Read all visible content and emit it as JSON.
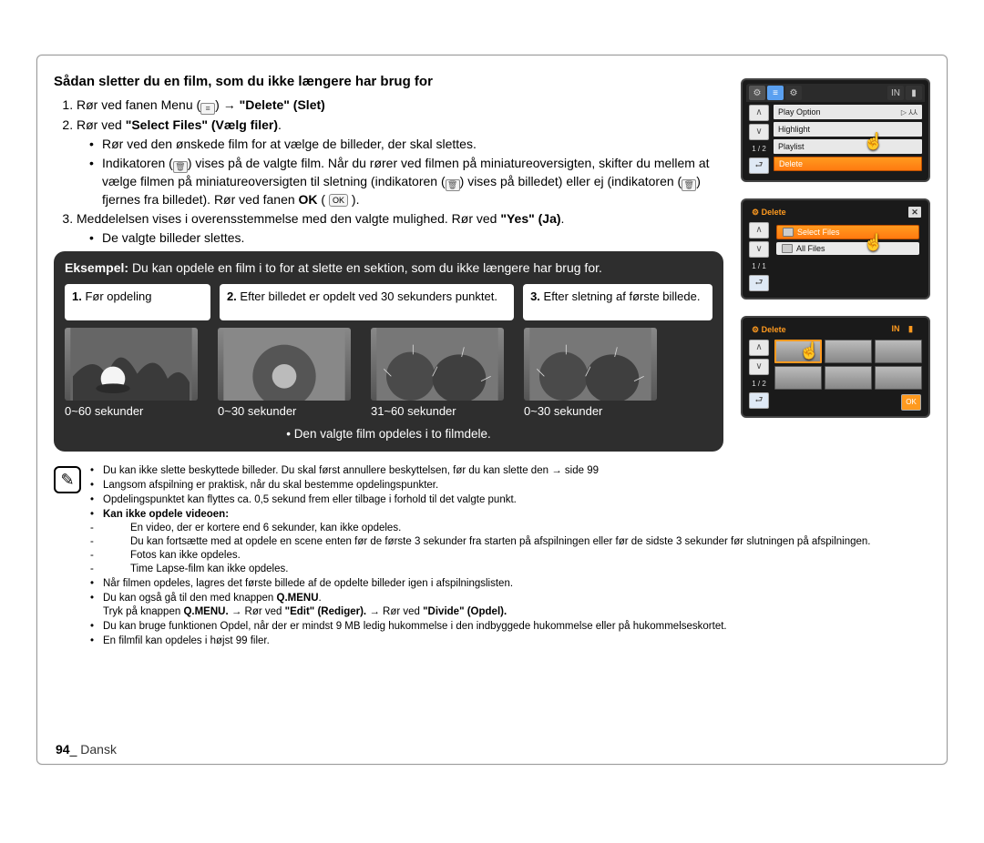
{
  "heading": "Sådan sletter du en film, som du ikke længere har brug for",
  "steps": {
    "s1_pre": "Rør ved fanen Menu (",
    "s1_post_a": ") ",
    "s1_arrow": "→",
    "s1_bold": " \"Delete\" (Slet)",
    "s2_pre": "Rør ved ",
    "s2_bold": "\"Select Files\" (Vælg filer)",
    "s2_sub1": "Rør ved den ønskede film for at vælge de billeder, der skal slettes.",
    "s2_sub2_a": "Indikatoren (",
    "s2_sub2_b": ") vises på de valgte film. Når du rører ved filmen på miniatureoversigten, skifter du mellem at vælge filmen på miniatureoversigten til sletning (indikatoren (",
    "s2_sub2_c": ") vises på billedet) eller ej (indikatoren (",
    "s2_sub2_d": ") fjernes fra billedet). Rør ved fanen ",
    "s2_sub2_ok": "OK",
    "s2_sub2_ok_badge": "OK",
    "s3_a": "Meddelelsen vises i overensstemmelse med den valgte mulighed. Rør ved ",
    "s3_b_bold": "\"Yes\" (Ja)",
    "s3_sub1": "De valgte billeder slettes."
  },
  "example": {
    "label": "Eksempel:",
    "text": "Du kan opdele en film i to for at slette en sektion, som du ikke længere har brug for.",
    "step1_num": "1.",
    "step1": " Før opdeling",
    "step2_num": "2.",
    "step2": " Efter billedet er opdelt ved 30 sekunders punktet.",
    "step3_num": "3.",
    "step3": " Efter sletning af første billede.",
    "cap1": "0~60 sekunder",
    "cap2": "0~30 sekunder",
    "cap3": "31~60 sekunder",
    "cap4": "0~30 sekunder",
    "final": "Den valgte film opdeles i to filmdele."
  },
  "notes": {
    "n1_a": "Du kan ikke slette beskyttede billeder. Du skal først annullere beskyttelsen, før du kan slette den ",
    "n1_arrow": "→",
    "n1_b": "side 99",
    "n2": "Langsom afspilning er praktisk, når du skal bestemme opdelingspunkter.",
    "n3": "Opdelingspunktet kan flyttes ca. 0,5 sekund frem eller tilbage i forhold til det valgte punkt.",
    "n4_b": "Kan ikke opdele videoen:",
    "n4_1": "En video, der er kortere end 6 sekunder, kan ikke opdeles.",
    "n4_2": "Du kan fortsætte med at opdele en scene enten før de første 3 sekunder fra starten på afspilningen eller før de sidste 3 sekunder før slutningen på afspilningen.",
    "n4_3": "Fotos kan ikke opdeles.",
    "n4_4": "Time Lapse-film kan ikke opdeles.",
    "n5": "Når filmen opdeles, lagres det første billede af de opdelte billeder igen i afspilningslisten.",
    "n6_a": "Du kan også gå til den med knappen ",
    "n6_b": "Q.MENU",
    "n6_c": ".",
    "n6_line2_a": "Tryk på knappen ",
    "n6_line2_b": "Q.MENU.",
    "n6_line2_c": " → Rør ved ",
    "n6_line2_d": "\"Edit\" (Rediger).",
    "n6_line2_e": " → Rør ved ",
    "n6_line2_f": "\"Divide\" (Opdel).",
    "n7": "Du kan bruge funktionen Opdel, når der er mindst 9 MB ledig hukommelse i den indbyggede hukommelse eller på hukommelseskortet.",
    "n8": "En filmfil kan opdeles i højst 99 filer."
  },
  "page": {
    "num": "94",
    "sep": "_ ",
    "lang": "Dansk"
  },
  "screens": {
    "s1": {
      "menu": [
        "Play Option",
        "Highlight",
        "Playlist",
        "Delete"
      ],
      "play_sym": "▷ ⅄⅄",
      "pg": "1 / 2"
    },
    "s2": {
      "title": "Delete",
      "opt_sel": "Select Files",
      "opt_all": "All Files",
      "pg": "1 / 1"
    },
    "s3": {
      "title": "Delete",
      "pg": "1 / 2",
      "ok": "OK"
    }
  }
}
